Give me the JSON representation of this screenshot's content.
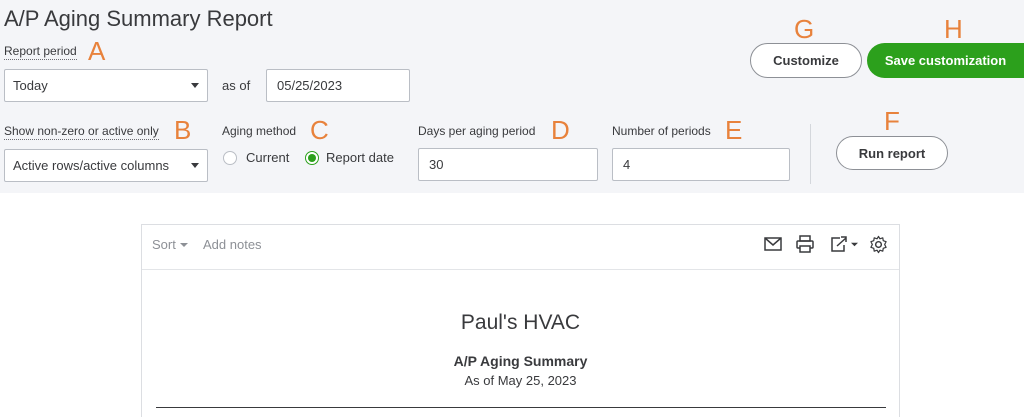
{
  "page": {
    "title": "A/P Aging Summary Report"
  },
  "report_period": {
    "label": "Report period",
    "letter": "A",
    "selected": "Today",
    "as_of_label": "as of",
    "date_value": "05/25/2023"
  },
  "show_nonzero": {
    "label": "Show non-zero or active only",
    "letter": "B",
    "selected": "Active rows/active columns"
  },
  "aging_method": {
    "label": "Aging method",
    "letter": "C",
    "options": [
      "Current",
      "Report date"
    ],
    "selected": "Report date"
  },
  "days_per_period": {
    "label": "Days per aging period",
    "letter": "D",
    "value": "30"
  },
  "num_periods": {
    "label": "Number of periods",
    "letter": "E",
    "value": "4"
  },
  "run_report": {
    "label": "Run report",
    "letter": "F"
  },
  "customize": {
    "label": "Customize",
    "letter": "G"
  },
  "save_customization": {
    "label": "Save customization",
    "letter": "H"
  },
  "report_toolbar": {
    "sort_label": "Sort",
    "add_notes_label": "Add notes",
    "icons": [
      "mail-icon",
      "print-icon",
      "export-icon",
      "gear-icon"
    ]
  },
  "report": {
    "company": "Paul's HVAC",
    "title": "A/P Aging Summary",
    "date_line": "As of May 25, 2023"
  },
  "colors": {
    "accent_green": "#2ca01c",
    "annotation_orange": "#e8823c",
    "panel_bg": "#f4f5f8"
  }
}
